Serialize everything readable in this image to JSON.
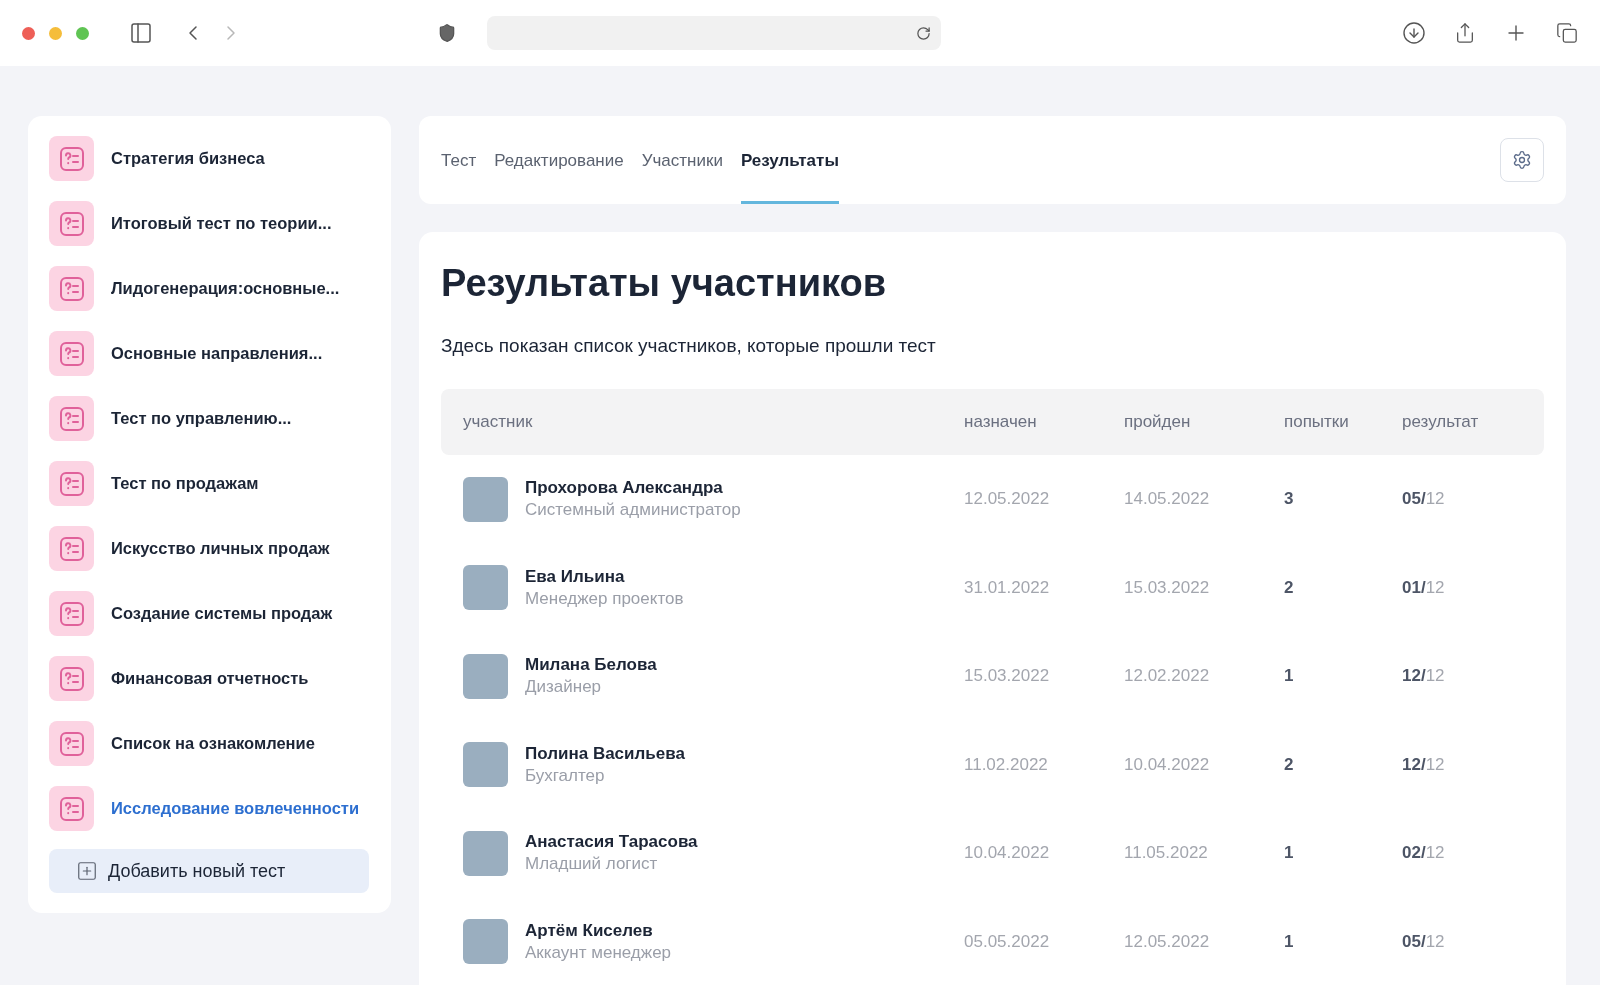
{
  "sidebar": {
    "items": [
      {
        "label": "Стратегия бизнеса",
        "selected": false
      },
      {
        "label": "Итоговый тест по теории...",
        "selected": false
      },
      {
        "label": "Лидогенерация:основные...",
        "selected": false
      },
      {
        "label": "Основные направления...",
        "selected": false
      },
      {
        "label": "Тест по управлению...",
        "selected": false
      },
      {
        "label": "Тест по продажам",
        "selected": false
      },
      {
        "label": "Искусство личных продаж",
        "selected": false
      },
      {
        "label": "Создание системы продаж",
        "selected": false
      },
      {
        "label": "Финансовая отчетность",
        "selected": false
      },
      {
        "label": "Список на ознакомление",
        "selected": false
      },
      {
        "label": "Исследование вовлеченности",
        "selected": true
      }
    ],
    "add_button": "Добавить новый тест"
  },
  "tabs": [
    {
      "label": "Тест",
      "selected": false
    },
    {
      "label": "Редактирование",
      "selected": false
    },
    {
      "label": "Участники",
      "selected": false
    },
    {
      "label": "Результаты",
      "selected": true
    }
  ],
  "title": "Результаты участников",
  "subtitle": "Здесь показан список участников, которые прошли тест",
  "table": {
    "columns": [
      "участник",
      "назначен",
      "пройден",
      "попытки",
      "результат"
    ],
    "rows": [
      {
        "name": "Прохорова Александра",
        "role": "Системный администратор",
        "assigned": "12.05.2022",
        "passed": "14.05.2022",
        "attempts": "3",
        "result": "**05/**12"
      },
      {
        "name": "Ева Ильина",
        "role": "Менеджер проектов",
        "assigned": "31.01.2022",
        "passed": "15.03.2022",
        "attempts": "2",
        "result": "**01/**12"
      },
      {
        "name": "Милана Белова",
        "role": "Дизайнер",
        "assigned": "15.03.2022",
        "passed": "12.02.2022",
        "attempts": "1",
        "result": "**12/**12"
      },
      {
        "name": "Полина Васильева",
        "role": "Бухгалтер",
        "assigned": "11.02.2022",
        "passed": "10.04.2022",
        "attempts": "2",
        "result": "**12/**12"
      },
      {
        "name": "Анастасия Тарасова",
        "role": "Младший логист",
        "assigned": "10.04.2022",
        "passed": "11.05.2022",
        "attempts": "1",
        "result": "**02/**12"
      },
      {
        "name": "Артём Киселев",
        "role": "Аккаунт менеджер",
        "assigned": "05.05.2022",
        "passed": "12.05.2022",
        "attempts": "1",
        "result": "**05/**12"
      }
    ]
  }
}
